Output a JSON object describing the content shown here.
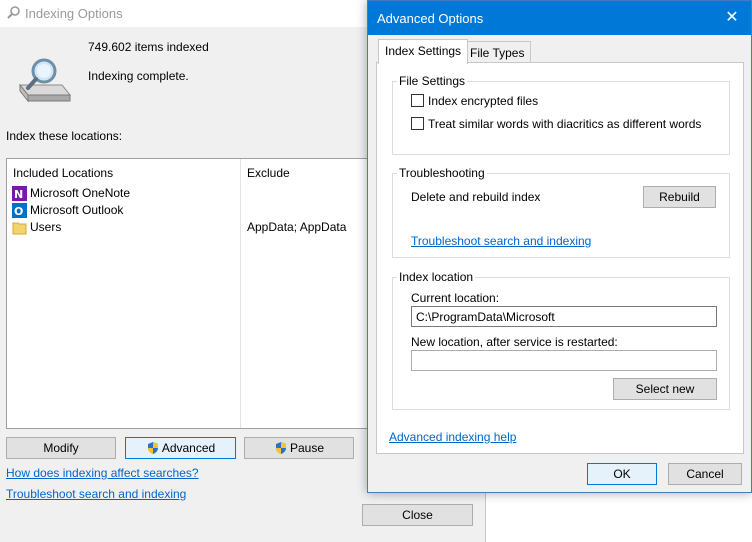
{
  "indexing_window": {
    "title": "Indexing Options",
    "items_indexed": "749.602 items indexed",
    "status": "Indexing complete.",
    "locations_label": "Index these locations:",
    "columns": {
      "included": "Included Locations",
      "exclude": "Exclude"
    },
    "locations": [
      {
        "name": "Microsoft OneNote",
        "exclude": "",
        "icon": "onenote-icon",
        "color": "#7719aa"
      },
      {
        "name": "Microsoft Outlook",
        "exclude": "",
        "icon": "outlook-icon",
        "color": "#0072c6"
      },
      {
        "name": "Users",
        "exclude": "AppData; AppData",
        "icon": "folder-icon",
        "color": "#f3d36b"
      }
    ],
    "buttons": {
      "modify": "Modify",
      "advanced": "Advanced",
      "pause": "Pause",
      "close": "Close"
    },
    "links": {
      "how_affects": "How does indexing affect searches?",
      "troubleshoot": "Troubleshoot search and indexing"
    }
  },
  "advanced_dialog": {
    "title": "Advanced Options",
    "tabs": [
      "Index Settings",
      "File Types"
    ],
    "file_settings": {
      "title": "File Settings",
      "encrypt_label": "Index encrypted files",
      "encrypt_checked": false,
      "diacritics_label": "Treat similar words with diacritics as different words",
      "diacritics_checked": false
    },
    "troubleshooting": {
      "title": "Troubleshooting",
      "rebuild_text": "Delete and rebuild index",
      "rebuild_button": "Rebuild",
      "troubleshoot_link": "Troubleshoot search and indexing"
    },
    "index_location": {
      "title": "Index location",
      "current_label": "Current location:",
      "current_value": "C:\\ProgramData\\Microsoft",
      "new_label": "New location, after service is restarted:",
      "new_value": "",
      "select_new_button": "Select new"
    },
    "help_link": "Advanced indexing help",
    "ok_button": "OK",
    "cancel_button": "Cancel"
  }
}
